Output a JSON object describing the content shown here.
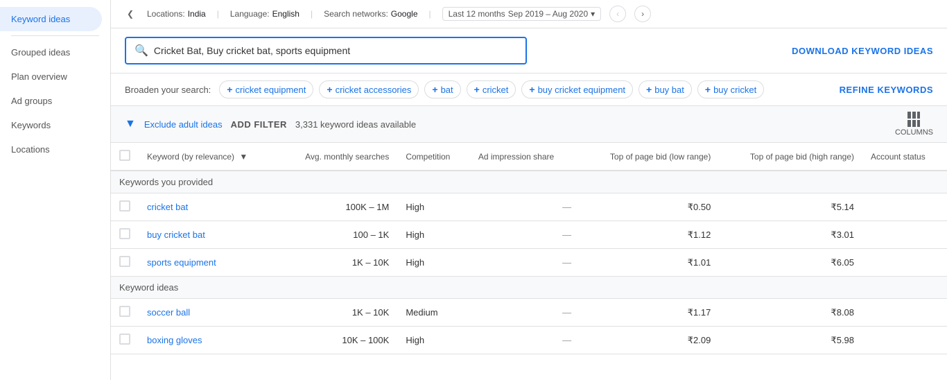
{
  "sidebar": {
    "items": [
      {
        "id": "keyword-ideas",
        "label": "Keyword ideas",
        "active": true
      },
      {
        "id": "grouped-ideas",
        "label": "Grouped ideas",
        "active": false
      },
      {
        "id": "plan-overview",
        "label": "Plan overview",
        "active": false
      },
      {
        "id": "ad-groups",
        "label": "Ad groups",
        "active": false
      },
      {
        "id": "keywords",
        "label": "Keywords",
        "active": false
      },
      {
        "id": "locations",
        "label": "Locations",
        "active": false
      }
    ]
  },
  "topbar": {
    "locations_label": "Locations:",
    "locations_value": "India",
    "language_label": "Language:",
    "language_value": "English",
    "search_networks_label": "Search networks:",
    "search_networks_value": "Google",
    "date_label": "Last 12 months",
    "date_range": "Sep 2019 – Aug 2020"
  },
  "search": {
    "value": "Cricket Bat, Buy cricket bat, sports equipment",
    "download_label": "DOWNLOAD KEYWORD IDEAS"
  },
  "broaden": {
    "label": "Broaden your search:",
    "chips": [
      {
        "id": "cricket-equipment",
        "label": "cricket equipment"
      },
      {
        "id": "cricket-accessories",
        "label": "cricket accessories"
      },
      {
        "id": "bat",
        "label": "bat"
      },
      {
        "id": "cricket",
        "label": "cricket"
      },
      {
        "id": "buy-cricket-equipment",
        "label": "buy cricket equipment"
      },
      {
        "id": "buy-bat",
        "label": "buy bat"
      },
      {
        "id": "buy-cricket",
        "label": "buy cricket"
      }
    ],
    "refine_label": "REFINE KEYWORDS"
  },
  "filter_bar": {
    "exclude_label": "Exclude adult ideas",
    "add_filter_label": "ADD FILTER",
    "keyword_count": "3,331 keyword ideas available",
    "columns_label": "COLUMNS"
  },
  "table": {
    "columns": [
      {
        "id": "keyword",
        "label": "Keyword (by relevance)",
        "sortable": true
      },
      {
        "id": "avg-monthly",
        "label": "Avg. monthly searches",
        "align": "right"
      },
      {
        "id": "competition",
        "label": "Competition"
      },
      {
        "id": "ad-impression",
        "label": "Ad impression share"
      },
      {
        "id": "top-bid-low",
        "label": "Top of page bid (low range)",
        "align": "right"
      },
      {
        "id": "top-bid-high",
        "label": "Top of page bid (high range)",
        "align": "right"
      },
      {
        "id": "account-status",
        "label": "Account status"
      }
    ],
    "sections": [
      {
        "id": "provided",
        "label": "Keywords you provided",
        "rows": [
          {
            "keyword": "cricket bat",
            "avg_monthly": "100K – 1M",
            "competition": "High",
            "ad_impression": "—",
            "bid_low": "₹0.50",
            "bid_high": "₹5.14",
            "account_status": ""
          },
          {
            "keyword": "buy cricket bat",
            "avg_monthly": "100 – 1K",
            "competition": "High",
            "ad_impression": "—",
            "bid_low": "₹1.12",
            "bid_high": "₹3.01",
            "account_status": ""
          },
          {
            "keyword": "sports equipment",
            "avg_monthly": "1K – 10K",
            "competition": "High",
            "ad_impression": "—",
            "bid_low": "₹1.01",
            "bid_high": "₹6.05",
            "account_status": ""
          }
        ]
      },
      {
        "id": "ideas",
        "label": "Keyword ideas",
        "rows": [
          {
            "keyword": "soccer ball",
            "avg_monthly": "1K – 10K",
            "competition": "Medium",
            "ad_impression": "—",
            "bid_low": "₹1.17",
            "bid_high": "₹8.08",
            "account_status": ""
          },
          {
            "keyword": "boxing gloves",
            "avg_monthly": "10K – 100K",
            "competition": "High",
            "ad_impression": "—",
            "bid_low": "₹2.09",
            "bid_high": "₹5.98",
            "account_status": ""
          }
        ]
      }
    ]
  }
}
